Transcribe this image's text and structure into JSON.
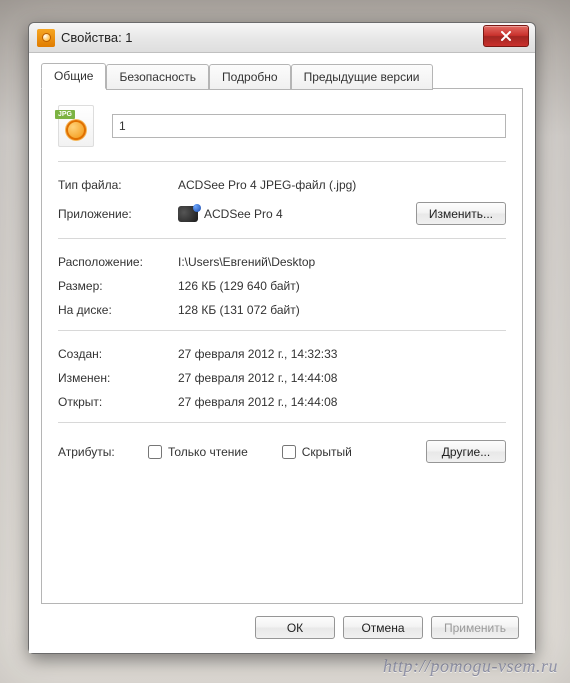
{
  "window": {
    "title": "Свойства: 1"
  },
  "tabs": [
    {
      "label": "Общие",
      "active": true
    },
    {
      "label": "Безопасность",
      "active": false
    },
    {
      "label": "Подробно",
      "active": false
    },
    {
      "label": "Предыдущие версии",
      "active": false
    }
  ],
  "file": {
    "icon_badge": "JPG",
    "name": "1"
  },
  "props": {
    "type_label": "Тип файла:",
    "type_value": "ACDSee Pro 4 JPEG-файл (.jpg)",
    "app_label": "Приложение:",
    "app_value": "ACDSee Pro 4",
    "change_btn": "Изменить...",
    "location_label": "Расположение:",
    "location_value": "I:\\Users\\Евгений\\Desktop",
    "size_label": "Размер:",
    "size_value": "126 КБ (129 640 байт)",
    "ondisk_label": "На диске:",
    "ondisk_value": "128 КБ (131 072 байт)",
    "created_label": "Создан:",
    "created_value": "27 февраля 2012 г., 14:32:33",
    "modified_label": "Изменен:",
    "modified_value": "27 февраля 2012 г., 14:44:08",
    "accessed_label": "Открыт:",
    "accessed_value": "27 февраля 2012 г., 14:44:08"
  },
  "attributes": {
    "label": "Атрибуты:",
    "readonly_label": "Только чтение",
    "readonly_checked": false,
    "hidden_label": "Скрытый",
    "hidden_checked": false,
    "other_btn": "Другие..."
  },
  "buttons": {
    "ok": "ОК",
    "cancel": "Отмена",
    "apply": "Применить"
  },
  "watermark": "http://pomogu-vsem.ru"
}
